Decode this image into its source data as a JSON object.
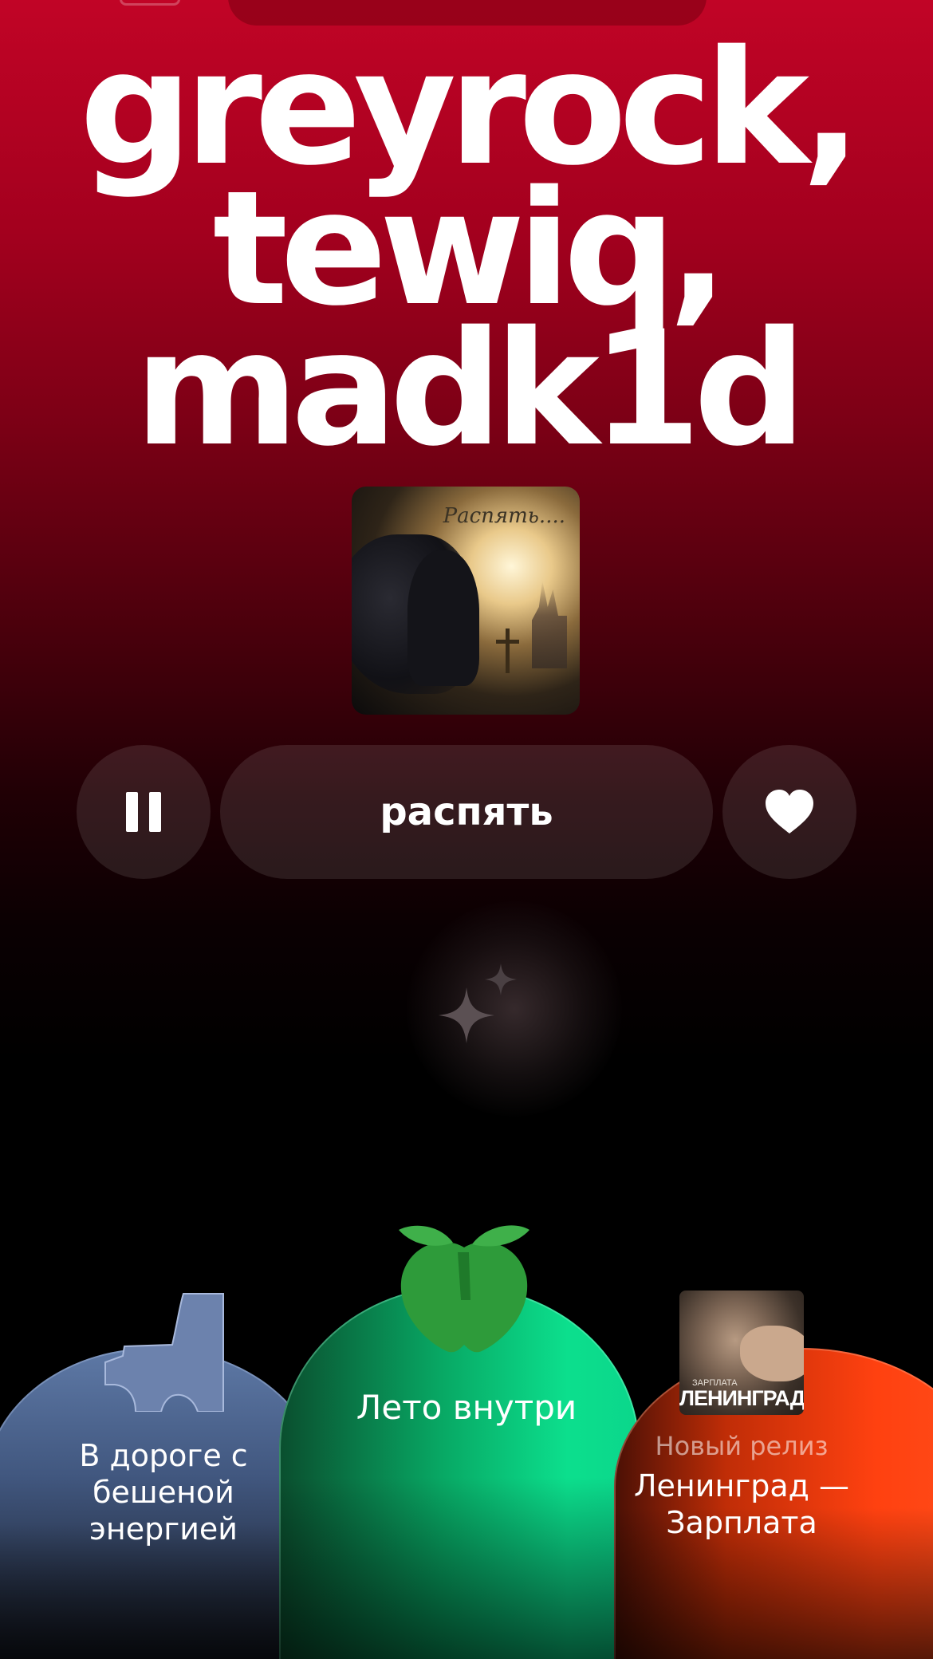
{
  "wave": {
    "title_lines": [
      "greyrock,",
      "tewiq,",
      "madk1d"
    ]
  },
  "cover": {
    "title": "Распять...."
  },
  "player": {
    "track_name": "распять",
    "pause_icon": "pause-icon",
    "like_icon": "heart-icon",
    "ai_icon": "sparkle-icon"
  },
  "cards": [
    {
      "title": "В дороге с бешеной энергией",
      "icon": "pipe-icon",
      "color": "#5e79a6"
    },
    {
      "title": "Лето внутри",
      "icon": "apple-icon",
      "color": "#0cdf8d"
    },
    {
      "subtitle": "Новый релиз",
      "title": "Ленинград — Зарплата",
      "color": "#ff4110",
      "thumb_small": "ЗАРПЛАТА",
      "thumb_big": "ЛЕНИНГРАД"
    }
  ]
}
